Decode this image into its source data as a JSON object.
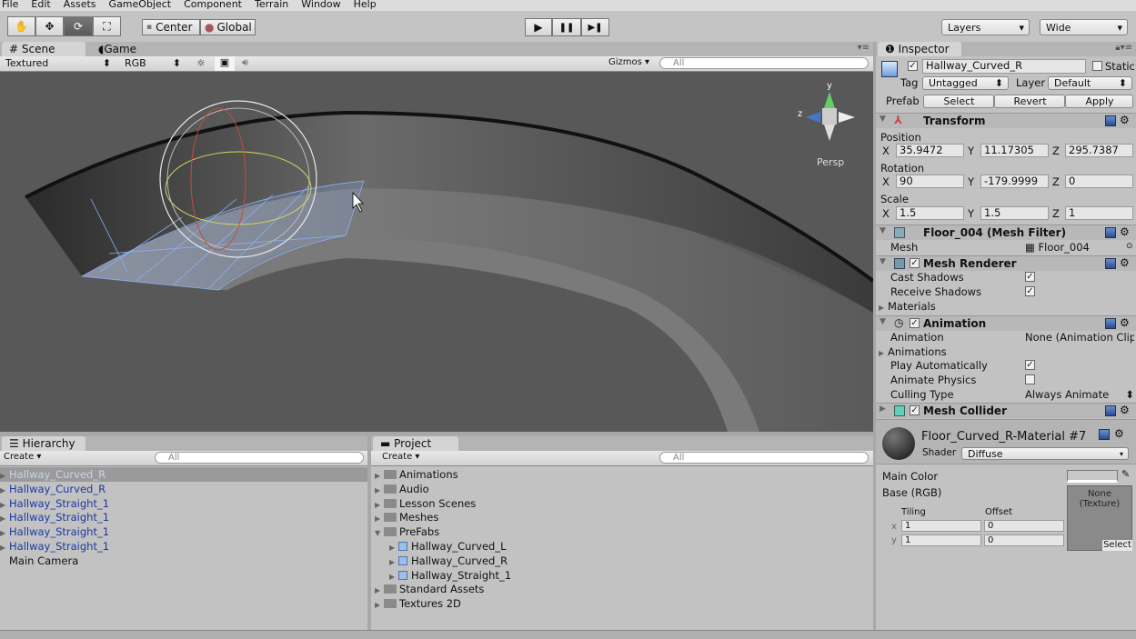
{
  "menu": [
    "File",
    "Edit",
    "Assets",
    "GameObject",
    "Component",
    "Terrain",
    "Window",
    "Help"
  ],
  "toolbar": {
    "tools": [
      "hand-tool",
      "move-tool",
      "rotate-tool",
      "scale-tool"
    ],
    "pivot": "Center",
    "space": "Global",
    "layers": "Layers",
    "layout": "Wide",
    "play": "▶",
    "pause": "❚❚",
    "step": "▶❚"
  },
  "scene": {
    "tab_scene": "Scene",
    "tab_game": "Game",
    "render_mode": "Textured",
    "color_mode": "RGB",
    "gizmos": "Gizmos",
    "search_placeholder": "All",
    "persp": "Persp",
    "axis_y": "y",
    "axis_z": "z"
  },
  "hierarchy": {
    "title": "Hierarchy",
    "create": "Create",
    "search_placeholder": "All",
    "items": [
      {
        "label": "Hallway_Curved_R",
        "selected": true
      },
      {
        "label": "Hallway_Curved_R"
      },
      {
        "label": "Hallway_Straight_1"
      },
      {
        "label": "Hallway_Straight_1"
      },
      {
        "label": "Hallway_Straight_1"
      },
      {
        "label": "Hallway_Straight_1"
      },
      {
        "label": "Main Camera"
      }
    ]
  },
  "project": {
    "title": "Project",
    "create": "Create",
    "search_placeholder": "All",
    "items": [
      {
        "label": "Animations",
        "level": 0
      },
      {
        "label": "Audio",
        "level": 0
      },
      {
        "label": "Lesson Scenes",
        "level": 0
      },
      {
        "label": "Meshes",
        "level": 0
      },
      {
        "label": "PreFabs",
        "level": 0,
        "open": true
      },
      {
        "label": "Hallway_Curved_L",
        "level": 1,
        "prefab": true
      },
      {
        "label": "Hallway_Curved_R",
        "level": 1,
        "prefab": true
      },
      {
        "label": "Hallway_Straight_1",
        "level": 1,
        "prefab": true
      },
      {
        "label": "Standard Assets",
        "level": 0
      },
      {
        "label": "Textures 2D",
        "level": 0
      }
    ]
  },
  "inspector": {
    "title": "Inspector",
    "object_name": "Hallway_Curved_R",
    "static_label": "Static",
    "tag_label": "Tag",
    "tag": "Untagged",
    "layer_label": "Layer",
    "layer": "Default",
    "prefab_label": "Prefab",
    "select": "Select",
    "revert": "Revert",
    "apply": "Apply",
    "transform": {
      "title": "Transform",
      "position_label": "Position",
      "rotation_label": "Rotation",
      "scale_label": "Scale",
      "position": {
        "x": "35.9472",
        "y": "11.17305",
        "z": "295.7387"
      },
      "rotation": {
        "x": "90",
        "y": "-179.9999",
        "z": "0"
      },
      "scale": {
        "x": "1.5",
        "y": "1.5",
        "z": "1"
      }
    },
    "mesh_filter": {
      "title": "Floor_004 (Mesh Filter)",
      "mesh_label": "Mesh",
      "mesh": "Floor_004"
    },
    "mesh_renderer": {
      "title": "Mesh Renderer",
      "cast_label": "Cast Shadows",
      "cast": true,
      "receive_label": "Receive Shadows",
      "receive": true,
      "materials_label": "Materials"
    },
    "animation": {
      "title": "Animation",
      "animation_label": "Animation",
      "animation": "None (Animation Clip)",
      "animations_label": "Animations",
      "play_label": "Play Automatically",
      "play": true,
      "physics_label": "Animate Physics",
      "physics": false,
      "culling_label": "Culling Type",
      "culling": "Always Animate"
    },
    "mesh_collider": {
      "title": "Mesh Collider"
    },
    "material": {
      "name": "Floor_Curved_R-Material #7",
      "shader_label": "Shader",
      "shader": "Diffuse",
      "main_color_label": "Main Color",
      "base_label": "Base (RGB)",
      "tiling_label": "Tiling",
      "offset_label": "Offset",
      "x_label": "x",
      "y_label": "y",
      "tiling_x": "1",
      "tiling_y": "1",
      "offset_x": "0",
      "offset_y": "0",
      "texture": "None (Texture)",
      "texture_select": "Select"
    }
  }
}
